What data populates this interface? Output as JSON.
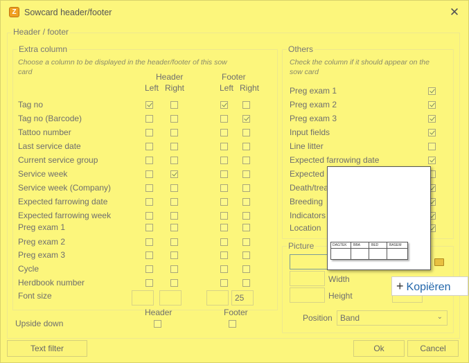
{
  "window": {
    "title": "Sowcard header/footer",
    "close_glyph": "✕"
  },
  "header_footer_group": {
    "label": "Header / footer"
  },
  "extra_column": {
    "label": "Extra column",
    "description_line1": "Choose a column to be displayed in the header/footer of this sow",
    "description_line2": "card",
    "col_header": "Header",
    "col_footer": "Footer",
    "left": "Left",
    "right": "Right",
    "rows": [
      {
        "label": "Tag no",
        "checks": [
          true,
          false,
          true,
          false
        ]
      },
      {
        "label": "Tag no (Barcode)",
        "checks": [
          false,
          false,
          false,
          true
        ]
      },
      {
        "label": "Tattoo number",
        "checks": [
          false,
          false,
          false,
          false
        ]
      },
      {
        "label": "Last service date",
        "checks": [
          false,
          false,
          false,
          false
        ]
      },
      {
        "label": "Current service group",
        "checks": [
          false,
          false,
          false,
          false
        ]
      },
      {
        "label": "Service week",
        "checks": [
          false,
          true,
          false,
          false
        ]
      },
      {
        "label": "Service week (Company)",
        "checks": [
          false,
          false,
          false,
          false
        ]
      },
      {
        "label": "Expected farrowing date",
        "checks": [
          false,
          false,
          false,
          false
        ]
      },
      {
        "label": "Expected farrowing week",
        "checks": [
          false,
          false,
          false,
          false
        ]
      },
      {
        "label": "Preg exam 1",
        "checks": [
          false,
          false,
          false,
          false
        ]
      },
      {
        "label": "Preg exam 2",
        "checks": [
          false,
          false,
          false,
          false
        ]
      },
      {
        "label": "Preg exam 3",
        "checks": [
          false,
          false,
          false,
          false
        ]
      },
      {
        "label": "Cycle",
        "checks": [
          false,
          false,
          false,
          false
        ]
      },
      {
        "label": "Herdbook number",
        "checks": [
          false,
          false,
          false,
          false
        ]
      }
    ],
    "font_size_label": "Font size",
    "font_size_values": [
      "",
      "",
      "",
      "25"
    ],
    "upside_down_label": "Upside down",
    "upside_header": "Header",
    "upside_footer": "Footer"
  },
  "others": {
    "label": "Others",
    "description_line1": "Check the column if it should appear on the",
    "description_line2": "sow card",
    "rows": [
      {
        "label": "Preg exam 1",
        "checked": true
      },
      {
        "label": "Preg exam 2",
        "checked": true
      },
      {
        "label": "Preg exam 3",
        "checked": true
      },
      {
        "label": "Input fields",
        "checked": true
      },
      {
        "label": "Line litter",
        "checked": false
      },
      {
        "label": "Expected farrowing date",
        "checked": true
      },
      {
        "label": "Expected",
        "checked": false
      },
      {
        "label": "Death/trea",
        "checked": true
      },
      {
        "label": "Breeding",
        "checked": true
      },
      {
        "label": "Indicators",
        "checked": true
      },
      {
        "label": "Location",
        "checked": true
      }
    ]
  },
  "picture": {
    "label": "Picture",
    "width_label": "Width",
    "height_label": "Height",
    "position_label": "Position",
    "position_value": "Band"
  },
  "preview": {
    "headers": [
      "DAGTEK",
      "BBA",
      "BED",
      "BASEM"
    ]
  },
  "drag_tooltip": {
    "label": "Kopiëren"
  },
  "buttons": {
    "text_filter": "Text filter",
    "ok": "Ok",
    "cancel": "Cancel"
  }
}
